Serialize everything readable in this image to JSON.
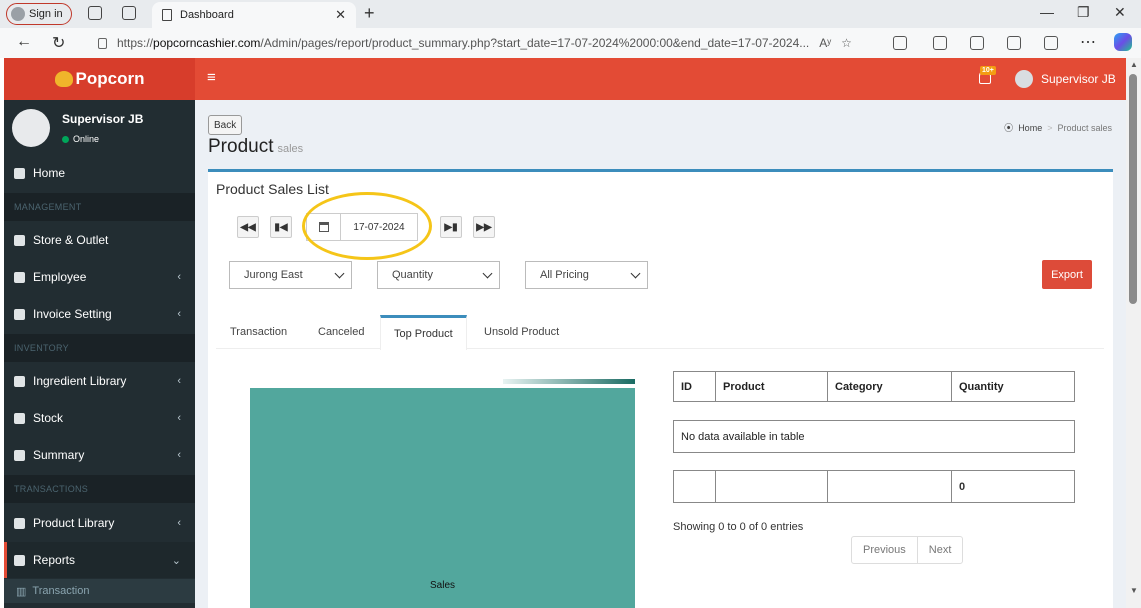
{
  "browser": {
    "signin_label": "Sign in",
    "tab_title": "Dashboard",
    "url_prefix": "https://",
    "url_host": "popcorncashier.com",
    "url_path": "/Admin/pages/report/product_summary.php?start_date=17-07-2024%2000:00&end_date=17-07-2024...",
    "read_aloud": "Aʸ"
  },
  "app": {
    "brand": "Popcorn",
    "user_name": "Supervisor JB",
    "notif_badge": "10+",
    "accent_color": "#e34b35",
    "sidebar_color": "#222d32"
  },
  "sidebar": {
    "user_name": "Supervisor JB",
    "status": "Online",
    "items": {
      "home": "Home",
      "management": "MANAGEMENT",
      "store": "Store & Outlet",
      "employee": "Employee",
      "invoice": "Invoice Setting",
      "inventory": "INVENTORY",
      "ingredient": "Ingredient Library",
      "stock": "Stock",
      "summary": "Summary",
      "transactions": "TRANSACTIONS",
      "product_library": "Product Library",
      "reports": "Reports",
      "transaction_sub": "Transaction"
    }
  },
  "page": {
    "back_label": "Back",
    "title": "Product",
    "subtitle": "sales",
    "breadcrumb_home": "Home",
    "breadcrumb_sep": ">",
    "breadcrumb_current": "Product sales",
    "box_title": "Product Sales List",
    "date_value": "17-07-2024",
    "outlet_select": "Jurong East",
    "metric_select": "Quantity",
    "pricing_select": "All Pricing",
    "export_label": "Export",
    "tabs": [
      "Transaction",
      "Canceled",
      "Top Product",
      "Unsold Product"
    ],
    "active_tab": "Top Product"
  },
  "chart_data": {
    "type": "heatmap",
    "categories": [
      "Sales"
    ],
    "values": [
      0
    ],
    "title": "",
    "xlabel": "",
    "ylabel": ""
  },
  "table": {
    "columns": [
      "ID",
      "Product",
      "Category",
      "Quantity"
    ],
    "empty_message": "No data available in table",
    "footer": [
      "",
      "",
      "",
      "0"
    ],
    "info": "Showing 0 to 0 of 0 entries",
    "prev_label": "Previous",
    "next_label": "Next"
  }
}
